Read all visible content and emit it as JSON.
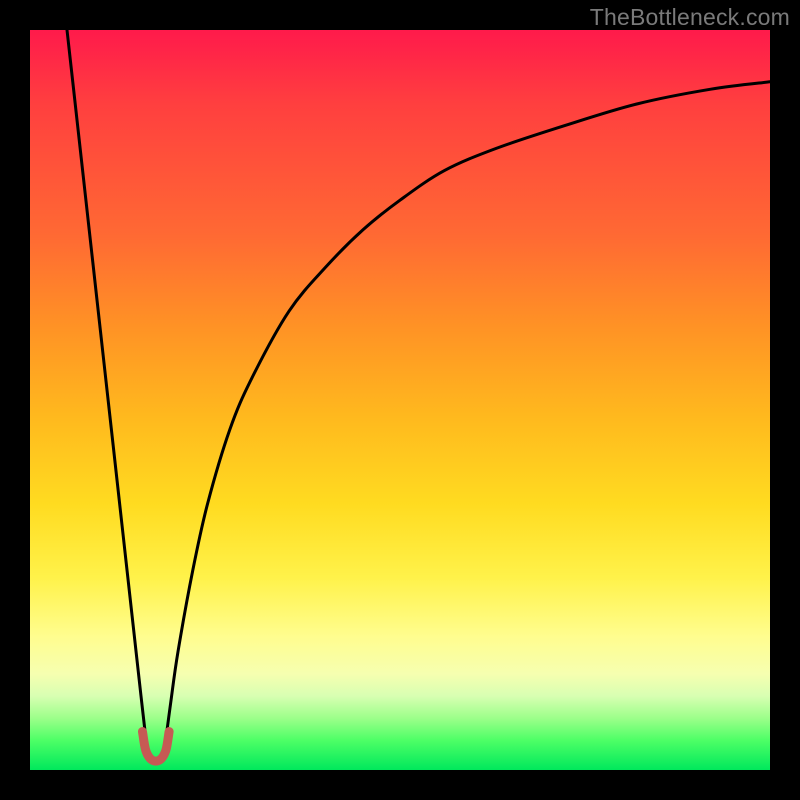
{
  "watermark": "TheBottleneck.com",
  "chart_data": {
    "type": "line",
    "title": "",
    "xlabel": "",
    "ylabel": "",
    "xlim": [
      0,
      100
    ],
    "ylim": [
      0,
      100
    ],
    "grid": false,
    "legend": null,
    "background_gradient": {
      "direction": "vertical",
      "stops": [
        {
          "pos": 0,
          "color": "#ff1a4b"
        },
        {
          "pos": 50,
          "color": "#ffb81e"
        },
        {
          "pos": 80,
          "color": "#fffd8f"
        },
        {
          "pos": 100,
          "color": "#00e85c"
        }
      ]
    },
    "series": [
      {
        "name": "left-branch",
        "color": "#000000",
        "x": [
          5.0,
          6.0,
          7.0,
          8.0,
          9.0,
          10.0,
          11.0,
          12.0,
          13.0,
          14.0,
          15.0,
          15.8
        ],
        "y": [
          100,
          91,
          82,
          73,
          64,
          55,
          46,
          37,
          28,
          19,
          10,
          3
        ]
      },
      {
        "name": "right-branch",
        "color": "#000000",
        "x": [
          18.2,
          19.0,
          20.0,
          22.0,
          24.0,
          27.0,
          30.0,
          35.0,
          40.0,
          45.0,
          50.0,
          56.0,
          63.0,
          72.0,
          82.0,
          92.0,
          100.0
        ],
        "y": [
          3,
          9,
          16,
          27,
          36,
          46,
          53,
          62,
          68,
          73,
          77,
          81,
          84,
          87,
          90,
          92,
          93
        ]
      },
      {
        "name": "dip-marker",
        "color": "#c65a54",
        "x": [
          15.2,
          15.6,
          16.2,
          17.0,
          17.8,
          18.4,
          18.8
        ],
        "y": [
          5.2,
          2.8,
          1.6,
          1.2,
          1.6,
          2.8,
          5.2
        ]
      }
    ]
  }
}
